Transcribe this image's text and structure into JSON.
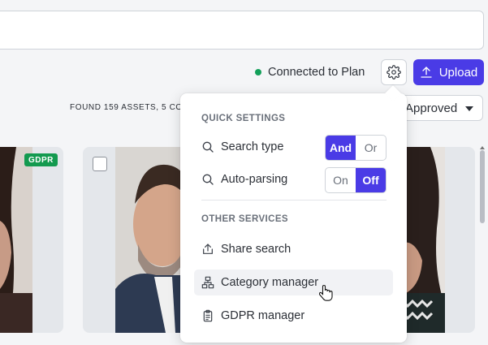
{
  "toolbar": {
    "status_text": "Connected to Plan",
    "upload_label": "Upload",
    "status_color": "#13a05a",
    "accent_color": "#4a3be6"
  },
  "results": {
    "found_text": "FOUND 159 ASSETS, 5 CO",
    "approval_filter": "Approved"
  },
  "cards": {
    "gdpr_badge": "GDPR"
  },
  "quick_settings": {
    "title": "QUICK SETTINGS",
    "search_type": {
      "label": "Search type",
      "options": [
        "And",
        "Or"
      ],
      "selected": "And"
    },
    "auto_parsing": {
      "label": "Auto-parsing",
      "options": [
        "On",
        "Off"
      ],
      "selected": "Off"
    }
  },
  "other_services": {
    "title": "OTHER SERVICES",
    "items": [
      {
        "label": "Share search",
        "icon": "share-icon"
      },
      {
        "label": "Category manager",
        "icon": "sitemap-icon"
      },
      {
        "label": "GDPR manager",
        "icon": "clipboard-icon"
      }
    ]
  }
}
